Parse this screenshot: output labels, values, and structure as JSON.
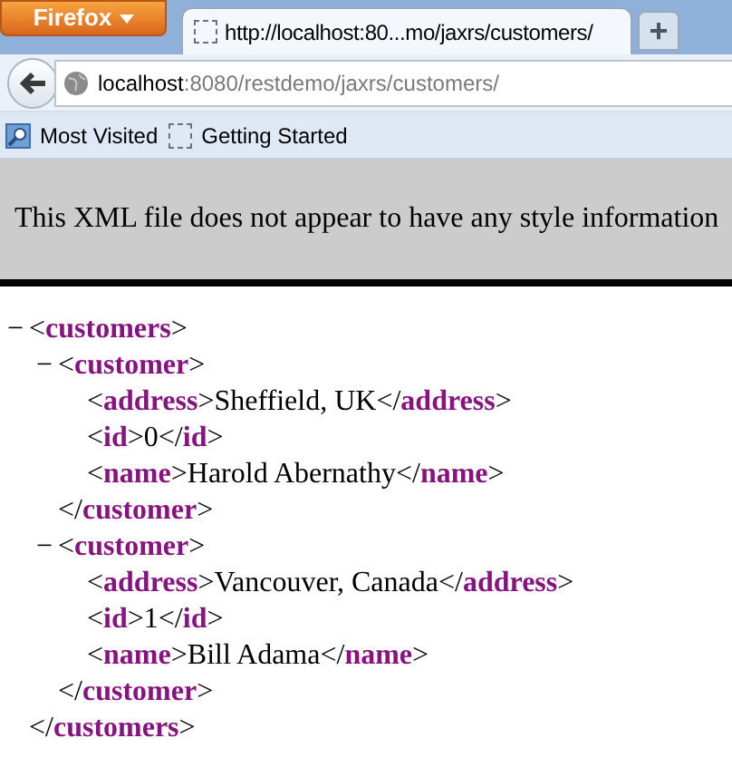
{
  "browser": {
    "app_button": "Firefox",
    "tab": {
      "title": "http://localhost:80...mo/jaxrs/customers/",
      "selected": true
    },
    "new_tab": "+"
  },
  "address_bar": {
    "host": "localhost",
    "rest": ":8080/restdemo/jaxrs/customers/"
  },
  "bookmarks": [
    {
      "label": "Most Visited",
      "kind": "folder"
    },
    {
      "label": "Getting Started",
      "kind": "page"
    }
  ],
  "info_message": "This XML file does not appear to have any style information",
  "xml_tree": [
    {
      "toggle": "−",
      "open": [
        "<",
        "customers",
        ">"
      ],
      "close": [
        "</",
        "customers",
        ">"
      ],
      "children": [
        {
          "toggle": "−",
          "open": [
            "<",
            "customer",
            ">"
          ],
          "close": [
            "</",
            "customer",
            ">"
          ],
          "children": [
            {
              "open": [
                "<",
                "address",
                ">"
              ],
              "text": "Sheffield, UK",
              "close": [
                "</",
                "address",
                ">"
              ]
            },
            {
              "open": [
                "<",
                "id",
                ">"
              ],
              "text": "0",
              "close": [
                "</",
                "id",
                ">"
              ]
            },
            {
              "open": [
                "<",
                "name",
                ">"
              ],
              "text": "Harold Abernathy",
              "close": [
                "</",
                "name",
                ">"
              ]
            }
          ]
        },
        {
          "toggle": "−",
          "open": [
            "<",
            "customer",
            ">"
          ],
          "close": [
            "</",
            "customer",
            ">"
          ],
          "children": [
            {
              "open": [
                "<",
                "address",
                ">"
              ],
              "text": "Vancouver, Canada",
              "close": [
                "</",
                "address",
                ">"
              ]
            },
            {
              "open": [
                "<",
                "id",
                ">"
              ],
              "text": "1",
              "close": [
                "</",
                "id",
                ">"
              ]
            },
            {
              "open": [
                "<",
                "name",
                ">"
              ],
              "text": "Bill Adama",
              "close": [
                "</",
                "name",
                ">"
              ]
            }
          ]
        }
      ]
    }
  ]
}
